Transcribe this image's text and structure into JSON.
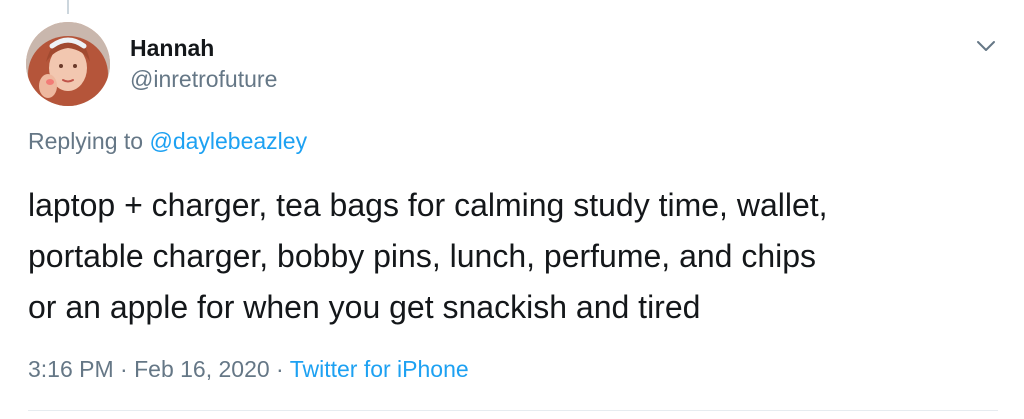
{
  "author": {
    "display_name": "Hannah",
    "handle": "@inretrofuture"
  },
  "reply": {
    "prefix": "Replying to ",
    "mention": "@daylebeazley"
  },
  "tweet": {
    "text": "laptop + charger, tea bags for calming study time, wallet,\nportable charger, bobby pins, lunch, perfume, and chips\nor an apple for when you get snackish and tired"
  },
  "meta": {
    "time": "3:16 PM",
    "separator1": " · ",
    "date": "Feb 16, 2020",
    "separator2": " · ",
    "source": "Twitter for iPhone"
  },
  "icons": {
    "menu": "chevron-down-icon",
    "avatar": "user-avatar"
  },
  "colors": {
    "link": "#1da1f2",
    "secondary_text": "#657786",
    "primary_text": "#14171a"
  }
}
